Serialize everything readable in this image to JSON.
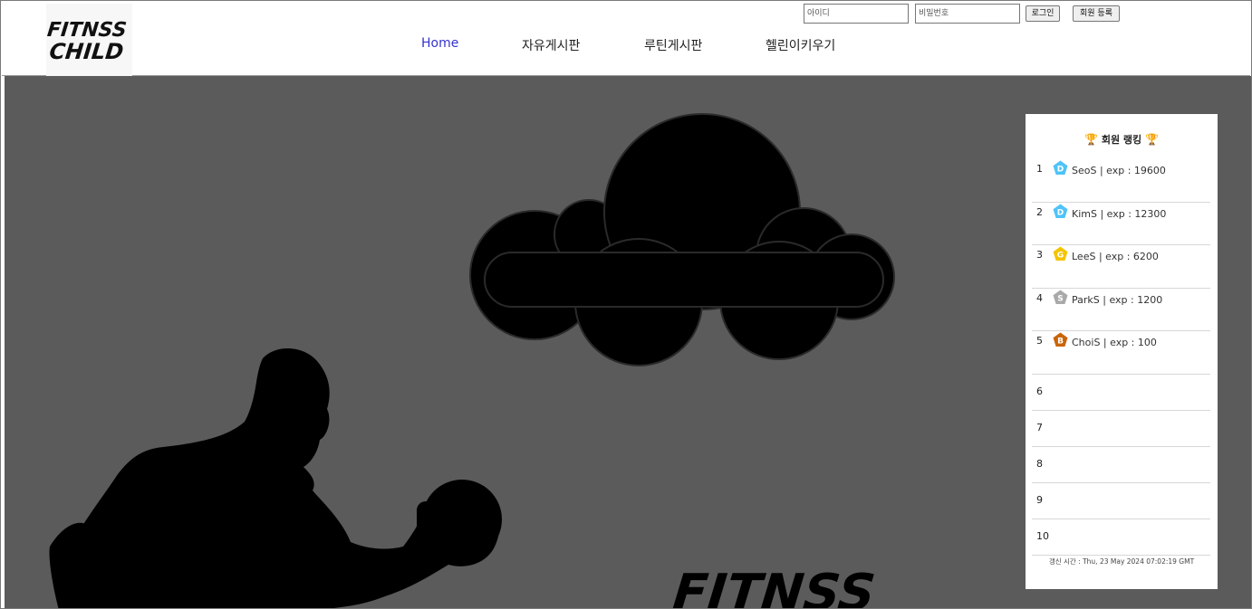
{
  "header": {
    "logo_line1": "FITNSS",
    "logo_line2": "CHILD",
    "nav": [
      {
        "label": "Home",
        "active": true
      },
      {
        "label": "자유게시판",
        "active": false
      },
      {
        "label": "루틴게시판",
        "active": false
      },
      {
        "label": "헬린이키우기",
        "active": false
      }
    ],
    "login": {
      "id_placeholder": "아이디",
      "pw_placeholder": "비밀번호",
      "login_label": "로그인",
      "signup_label": "회원 등록"
    }
  },
  "hero": {
    "watermark_text": "FITNSS"
  },
  "ranking": {
    "title": "회원 랭킹",
    "rows": [
      {
        "rank": "1",
        "tier": "D",
        "tier_color": "#4fc3f7",
        "text": "SeoS |  exp : 19600"
      },
      {
        "rank": "2",
        "tier": "D",
        "tier_color": "#4fc3f7",
        "text": "KimS |  exp : 12300"
      },
      {
        "rank": "3",
        "tier": "G",
        "tier_color": "#f5c400",
        "text": "LeeS |  exp : 6200"
      },
      {
        "rank": "4",
        "tier": "S",
        "tier_color": "#a9a9a9",
        "text": "ParkS |  exp : 1200"
      },
      {
        "rank": "5",
        "tier": "B",
        "tier_color": "#c8650a",
        "text": "ChoiS |  exp : 100"
      },
      {
        "rank": "6",
        "tier": "",
        "text": ""
      },
      {
        "rank": "7",
        "tier": "",
        "text": ""
      },
      {
        "rank": "8",
        "tier": "",
        "text": ""
      },
      {
        "rank": "9",
        "tier": "",
        "text": ""
      },
      {
        "rank": "10",
        "tier": "",
        "text": ""
      }
    ],
    "update_time": "갱신 시간 : Thu, 23 May 2024 07:02:19 GMT"
  },
  "colors": {
    "hero_bg": "#5b5b5b",
    "nav_active": "#3533cc"
  }
}
